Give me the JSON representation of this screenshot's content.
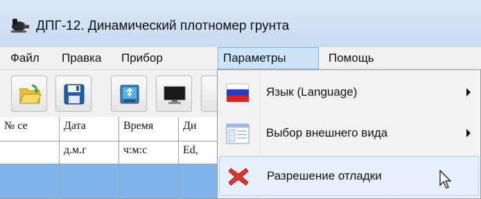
{
  "window": {
    "title": "ДПГ-12. Динамический плотномер грунта"
  },
  "menubar": {
    "items": [
      {
        "label": "Файл"
      },
      {
        "label": "Правка"
      },
      {
        "label": "Прибор"
      },
      {
        "label": "Параметры",
        "active": true
      },
      {
        "label": "Помощь"
      }
    ]
  },
  "toolbar": {
    "buttons": [
      {
        "icon": "open-folder-icon"
      },
      {
        "icon": "save-disk-icon"
      },
      {
        "icon": "usb-device-icon"
      },
      {
        "icon": "monitor-icon"
      }
    ]
  },
  "table": {
    "headers": [
      "№ се",
      "Дата",
      "Время",
      "Ди"
    ],
    "units": [
      "",
      "д.м.г",
      "ч:м:с",
      "Ed,"
    ]
  },
  "dropdown": {
    "items": [
      {
        "label": "Язык (Language)",
        "icon": "russian-flag-icon",
        "has_submenu": true
      },
      {
        "label": "Выбор внешнего вида",
        "icon": "window-layout-icon",
        "has_submenu": true
      },
      {
        "label": "Разрешение отладки",
        "icon": "red-x-icon",
        "has_submenu": false,
        "hovered": true
      }
    ]
  },
  "colors": {
    "title_bar": "#c9daf0",
    "menu_highlight": "#cce4f7",
    "row_selection": "#7fb5ea",
    "dropdown_bg": "#f2f2f2"
  }
}
